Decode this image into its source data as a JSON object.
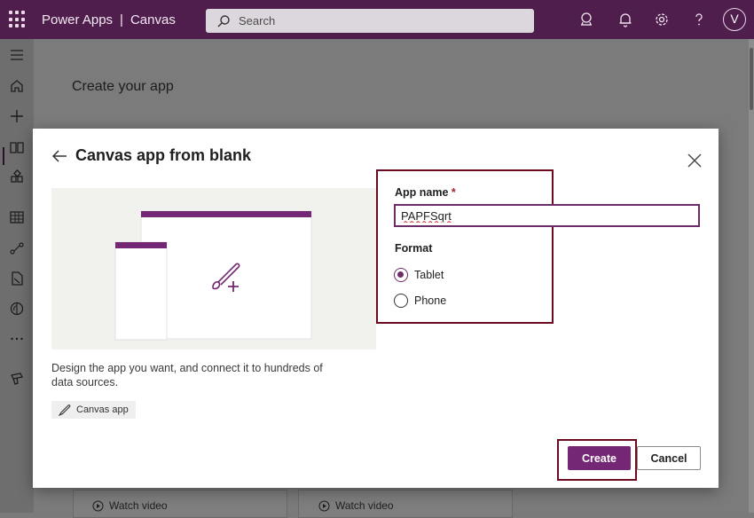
{
  "header": {
    "app_name": "Power Apps",
    "separator": "|",
    "section": "Canvas",
    "search_placeholder": "Search",
    "avatar_initial": "V",
    "icons": [
      "waffle-icon",
      "environment-icon",
      "bell-icon",
      "gear-icon",
      "help-icon"
    ]
  },
  "sidebar": {
    "icons": [
      "hamburger-icon",
      "home-icon",
      "plus-icon",
      "learn-icon",
      "apps-icon",
      "tables-icon",
      "flows-icon",
      "solutions-icon",
      "ai-icon",
      "more-icon",
      "power-platform-icon"
    ]
  },
  "page": {
    "title": "Create your app",
    "cards": [
      {
        "watch_label": "Watch video"
      },
      {
        "watch_label": "Watch video"
      }
    ]
  },
  "dialog": {
    "title": "Canvas app from blank",
    "description": "Design the app you want, and connect it to hundreds of data sources.",
    "chip_label": "Canvas app",
    "app_name_label": "App name",
    "required_marker": "*",
    "app_name_value": "PAPFSqrt",
    "format_label": "Format",
    "format_options": [
      {
        "label": "Tablet",
        "selected": true
      },
      {
        "label": "Phone",
        "selected": false
      }
    ],
    "create_label": "Create",
    "cancel_label": "Cancel"
  },
  "colors": {
    "brand_header": "#4f1e4d",
    "primary_button": "#742774",
    "highlight_box": "#6c0a20"
  }
}
